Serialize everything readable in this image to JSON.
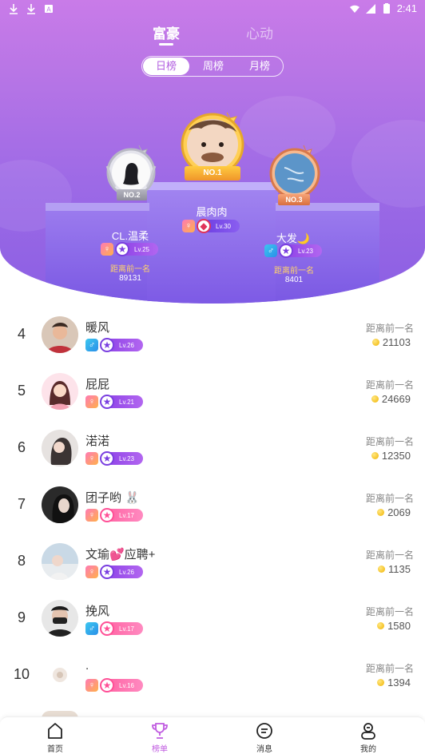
{
  "status": {
    "time": "2:41"
  },
  "top_tabs": [
    {
      "label": "富豪",
      "active": true
    },
    {
      "label": "心动",
      "active": false
    }
  ],
  "segments": [
    {
      "label": "日榜",
      "active": true
    },
    {
      "label": "周榜",
      "active": false
    },
    {
      "label": "月榜",
      "active": false
    }
  ],
  "podium": {
    "first": {
      "name": "晨肉肉",
      "rank_label": "NO.1",
      "level": "Lv.30",
      "gender": "female"
    },
    "second": {
      "name": "CL.温柔",
      "rank_label": "NO.2",
      "level": "Lv.25",
      "gender": "female",
      "dist_label": "距离前一名",
      "dist_value": "89131"
    },
    "third": {
      "name": "大发🌙",
      "rank_label": "NO.3",
      "level": "Lv.23",
      "gender": "male",
      "dist_label": "距离前一名",
      "dist_value": "8401"
    }
  },
  "list": {
    "dist_label": "距离前一名",
    "rows": [
      {
        "rank": "4",
        "name": "暖风",
        "gender": "male",
        "level": "Lv.26",
        "lv_style": "purple",
        "value": "21103"
      },
      {
        "rank": "5",
        "name": "屁屁",
        "gender": "female",
        "level": "Lv.21",
        "lv_style": "purple",
        "value": "24669"
      },
      {
        "rank": "6",
        "name": "渃渃",
        "gender": "female",
        "level": "Lv.23",
        "lv_style": "purple",
        "value": "12350"
      },
      {
        "rank": "7",
        "name": "团子哟 🐰",
        "gender": "female",
        "level": "Lv.17",
        "lv_style": "pink",
        "value": "2069"
      },
      {
        "rank": "8",
        "name": "文瑜💕应聘+",
        "gender": "female",
        "level": "Lv.26",
        "lv_style": "purple",
        "value": "1135"
      },
      {
        "rank": "9",
        "name": "挽风",
        "gender": "male",
        "level": "Lv.17",
        "lv_style": "pink",
        "value": "1580"
      },
      {
        "rank": "10",
        "name": ".",
        "gender": "female",
        "level": "Lv.16",
        "lv_style": "pink",
        "value": "1394"
      }
    ]
  },
  "nav": [
    {
      "label": "首页",
      "icon": "home-icon",
      "active": false
    },
    {
      "label": "榜单",
      "icon": "trophy-icon",
      "active": true
    },
    {
      "label": "消息",
      "icon": "message-icon",
      "active": false
    },
    {
      "label": "我的",
      "icon": "profile-icon",
      "active": false
    }
  ],
  "colors": {
    "accent": "#c05ce0",
    "hero_top": "#c97be8",
    "hero_bottom": "#8b5fe3",
    "coin": "#f1b400"
  }
}
